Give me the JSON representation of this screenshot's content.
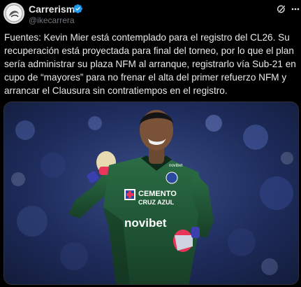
{
  "author": {
    "display_name": "Carrerismo",
    "handle": "@ikecarrera",
    "verified_icon": "verified-badge-icon"
  },
  "actions": {
    "grok_icon": "grok-icon",
    "more_icon": "more-horizontal-icon"
  },
  "tweet": {
    "text": "Fuentes: Kevin Mier está contemplado para el registro del CL26. Su recuperación está proyectada para final del torneo, por lo que el plan sería administrar su plaza NFM al arranque, registrarlo vía Sub-21 en cupo de “mayores” para no frenar el alta del primer refuerzo NFM y arrancar el Clausura sin contratiempos en el registro."
  },
  "media": {
    "jersey_sponsor_line1": "CEMENTO",
    "jersey_sponsor_line2": "CRUZ AZUL",
    "jersey_sponsor_main": "novibet",
    "jersey_sleeve": "novibet",
    "colors": {
      "jersey": "#1f5a36",
      "background": "#1c2a55",
      "glove_accent": "#e8365a",
      "verified": "#1d9bf0"
    }
  }
}
